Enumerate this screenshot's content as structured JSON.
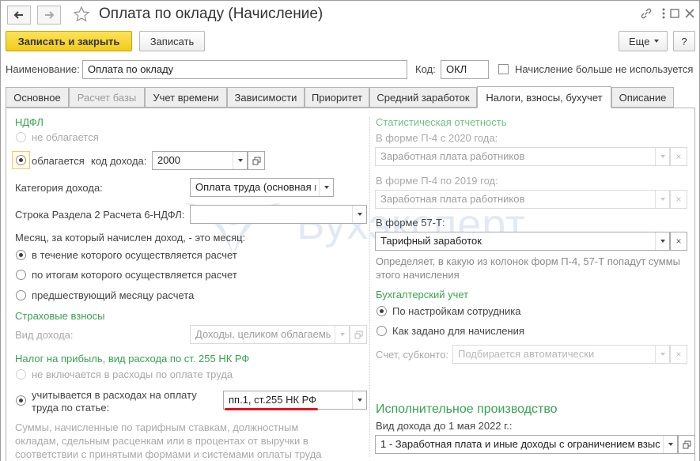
{
  "window": {
    "title": "Оплата по окладу (Начисление)",
    "icons": [
      "arrow-left-icon",
      "arrow-right-icon",
      "star-icon",
      "link-icon",
      "kebab-menu-icon",
      "maximize-icon",
      "close-icon"
    ]
  },
  "toolbar": {
    "save_close": "Записать и закрыть",
    "save": "Записать",
    "more": "Еще",
    "help": "?"
  },
  "header": {
    "name_label": "Наименование:",
    "name_value": "Оплата по окладу",
    "code_label": "Код:",
    "code_value": "ОКЛ",
    "unused_label": "Начисление больше не используется",
    "unused_checked": false
  },
  "tabs": [
    {
      "label": "Основное",
      "state": "normal"
    },
    {
      "label": "Расчет базы",
      "state": "disabled"
    },
    {
      "label": "Учет времени",
      "state": "normal"
    },
    {
      "label": "Зависимости",
      "state": "normal"
    },
    {
      "label": "Приоритет",
      "state": "normal"
    },
    {
      "label": "Средний заработок",
      "state": "normal"
    },
    {
      "label": "Налоги, взносы, бухучет",
      "state": "active"
    },
    {
      "label": "Описание",
      "state": "normal"
    }
  ],
  "left": {
    "ndfl_title": "НДФЛ",
    "ndfl_not_taxed": "не облагается",
    "ndfl_taxed": "облагается",
    "income_code_label": "код дохода:",
    "income_code_value": "2000",
    "income_category_label": "Категория дохода:",
    "income_category_value": "Оплата труда (основная н",
    "section2_label": "Строка Раздела 2 Расчета 6-НДФЛ:",
    "section2_value": "",
    "month_label": "Месяц, за который начислен доход, - это месяц:",
    "month_opt1": "в течение которого осуществляется расчет",
    "month_opt2": "по итогам которого осуществляется расчет",
    "month_opt3": "предшествующий месяцу расчета",
    "insurance_title": "Страховые взносы",
    "income_type_label": "Вид дохода:",
    "income_type_value": "Доходы, целиком облагаемы",
    "profit_title": "Налог на прибыль, вид расхода по ст. 255 НК РФ",
    "profit_opt1": "не включается в расходы по оплате труда",
    "profit_opt2_line1": "учитывается в расходах на оплату",
    "profit_opt2_line2": "труда по статье:",
    "profit_article_value": "пп.1, ст.255 НК РФ",
    "note_line1": "Суммы, начисленные по тарифным ставкам, должностным",
    "note_line2": "окладам, сдельным расценкам или в процентах от выручки в",
    "note_line3": "соответствии с принятыми формами и системами оплаты труда"
  },
  "right": {
    "stats_title": "Статистическая отчетность",
    "p4_2020_label": "В форме П-4 с 2020 года:",
    "p4_2020_value": "Заработная плата работников",
    "p4_2019_label": "В форме П-4 по 2019 год:",
    "p4_2019_value": "Заработная плата работников",
    "f57_label": "В форме 57-Т:",
    "f57_value": "Тарифный заработок",
    "f57_note_line1": "Определяет, в какую из колонок форм П-4, 57-Т попадут суммы",
    "f57_note_line2": "этого начисления",
    "accounting_title": "Бухгалтерский учет",
    "acc_opt1": "По настройкам сотрудника",
    "acc_opt2": "Как задано для начисления",
    "account_label": "Счет, субконто:",
    "account_placeholder": "Подбирается автоматически",
    "enforcement_title": "Исполнительное производство",
    "enforcement_label": "Вид дохода до 1 мая 2022 г.:",
    "enforcement_value": "1 - Заработная плата и иные доходы с ограничением взыс"
  },
  "watermark": {
    "text": "Бухэксперт"
  },
  "colors": {
    "accent_green": "#38a34f",
    "primary_yellow": "#f2cc19",
    "underline_red": "#e0141e",
    "watermark_blue": "#3470b8"
  }
}
